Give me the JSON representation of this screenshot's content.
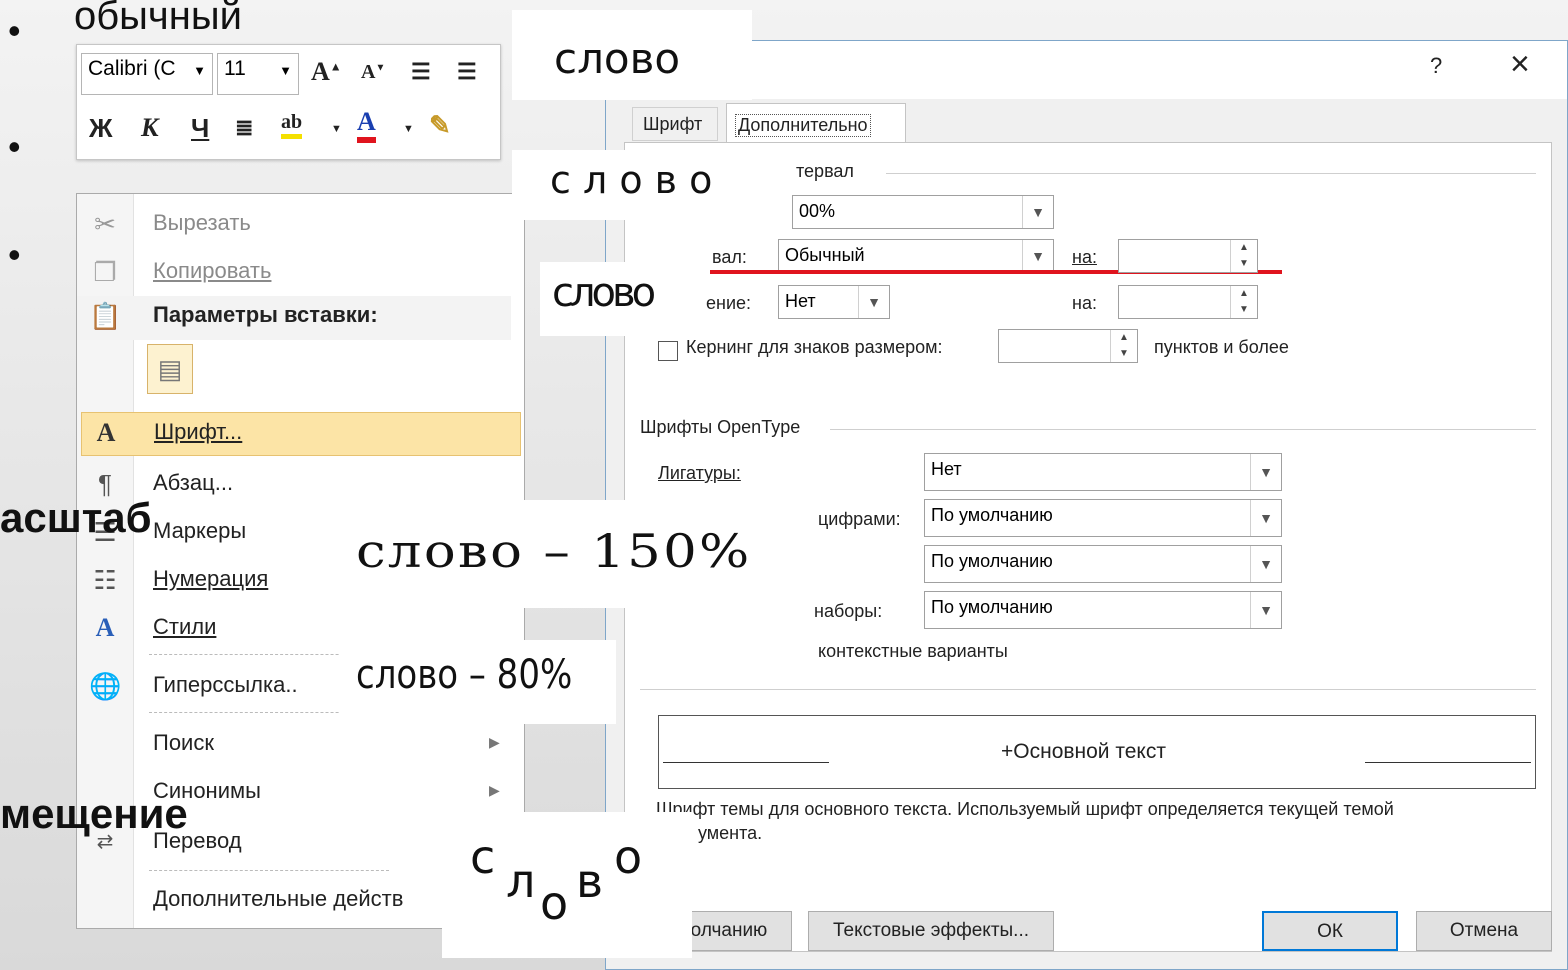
{
  "slide": {
    "bullet_1": "обычный",
    "label_scale": "асштаб",
    "label_offset": "мещение"
  },
  "mini_toolbar": {
    "font_name": "Calibri (С",
    "font_size": "11",
    "bold": "Ж",
    "italic": "К",
    "underline": "Ч"
  },
  "context_menu": {
    "items": [
      {
        "label": "Вырезать"
      },
      {
        "label": "Копировать"
      },
      {
        "label": "Параметры вставки:"
      },
      {
        "label": "Шрифт..."
      },
      {
        "label": "Абзац..."
      },
      {
        "label": "Маркеры"
      },
      {
        "label": "Нумерация"
      },
      {
        "label": "Стили"
      },
      {
        "label": "Гиперссылка.."
      },
      {
        "label": "Поиск"
      },
      {
        "label": "Синонимы"
      },
      {
        "label": "Перевод"
      },
      {
        "label": "Дополнительные действ"
      }
    ]
  },
  "dialog": {
    "help": "?",
    "close": "×",
    "tabs": {
      "font": "Шрифт",
      "advanced": "Дополнительно"
    },
    "spacing_group": "тервал",
    "scale_value": "00%",
    "spacing_label": "вал:",
    "spacing_value": "Обычный",
    "on_label_1": "на:",
    "position_label": "ение:",
    "position_value": "Нет",
    "on_label_2": "на:",
    "kerning_label": "Кернинг для знаков размером:",
    "kerning_suffix": "пунктов и более",
    "opentype_group": "Шрифты OpenType",
    "ligatures_label": "Лигатуры:",
    "ligatures_value": "Нет",
    "numbers_label": "цифрами:",
    "numbers_value": "По умолчанию",
    "forms_value": "По умолчанию",
    "sets_label": "наборы:",
    "sets_value": "По умолчанию",
    "contextual": "контекстные варианты",
    "preview_text": "+Основной текст",
    "description": "Шрифт темы для основного текста. Используемый шрифт определяется текущей темой",
    "description_2": "умента.",
    "default_button": "олчанию",
    "effects_button": "Текстовые эффекты...",
    "ok_button": "ОК",
    "cancel_button": "Отмена"
  },
  "samples": {
    "normal": "слово",
    "spaced": "с л о в о",
    "condensed": "слово",
    "scale_150": "слово – 150%",
    "scale_80": "слово – 80%",
    "offset": [
      "с",
      "л",
      "о",
      "в",
      "о"
    ]
  },
  "colors": {
    "highlight": "#fce4a6",
    "red_underline": "#e0141e",
    "dialog_border": "#7fa6c9"
  }
}
